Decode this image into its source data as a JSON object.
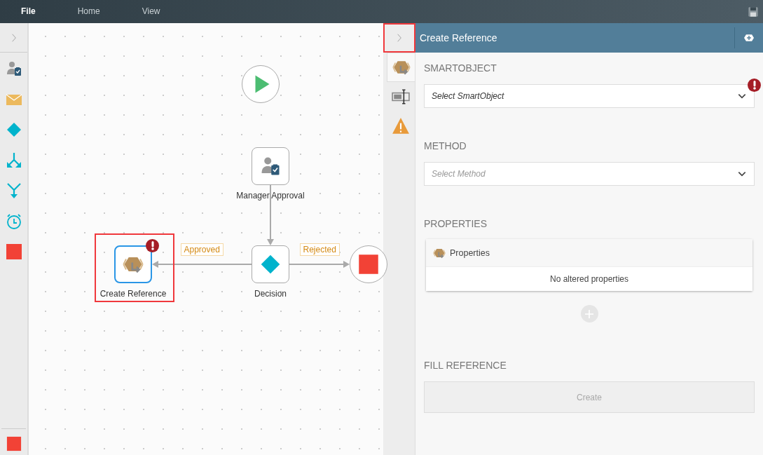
{
  "menu": [
    {
      "label": "File",
      "selected": true
    },
    {
      "label": "Home",
      "selected": false
    },
    {
      "label": "View",
      "selected": false
    }
  ],
  "toolbox": [
    {
      "kind": "user-task"
    },
    {
      "kind": "email"
    },
    {
      "kind": "decision"
    },
    {
      "kind": "split"
    },
    {
      "kind": "merge"
    },
    {
      "kind": "timer"
    },
    {
      "kind": "end"
    }
  ],
  "toolbox_footer": [
    {
      "kind": "end"
    }
  ],
  "canvas": {
    "nodes": [
      {
        "kind": "start",
        "selected": false,
        "error": false,
        "highlighted": false
      },
      {
        "kind": "user-task",
        "label": "Manager Approval",
        "selected": false,
        "error": false,
        "highlighted": false
      },
      {
        "kind": "decision",
        "label": "Decision",
        "selected": false,
        "error": false,
        "highlighted": false
      },
      {
        "kind": "reference",
        "label": "Create Reference",
        "selected": true,
        "error": true,
        "highlighted": true
      },
      {
        "kind": "end",
        "selected": false,
        "error": false,
        "highlighted": false
      }
    ],
    "branch_labels": [
      "Approved",
      "Rejected"
    ]
  },
  "panel": {
    "title": "Create Reference",
    "collapse_highlighted": true,
    "side_tabs": [
      {
        "kind": "reference",
        "selected": true
      },
      {
        "kind": "field",
        "selected": false
      },
      {
        "kind": "warning",
        "selected": false
      }
    ],
    "smartobject": {
      "heading": "SMARTOBJECT",
      "placeholder": "Select SmartObject",
      "error": true
    },
    "method": {
      "heading": "METHOD",
      "placeholder": "Select Method",
      "error": false
    },
    "properties": {
      "heading": "PROPERTIES",
      "card_title": "Properties",
      "empty_text": "No altered properties",
      "add_disabled": true
    },
    "fill_reference": {
      "heading": "FILL REFERENCE",
      "button": "Create",
      "disabled": true
    }
  }
}
